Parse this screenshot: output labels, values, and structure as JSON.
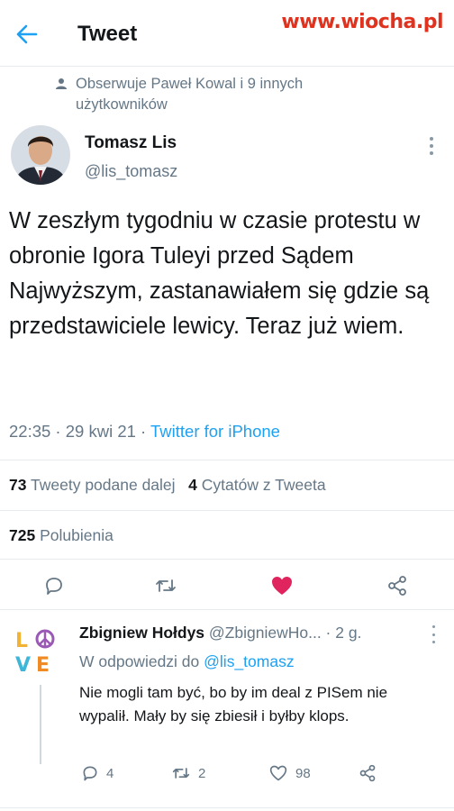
{
  "header": {
    "title": "Tweet"
  },
  "watermark": "www.wiocha.pl",
  "social_context": "Obserwuje Paweł Kowal i 9 innych użytkowników",
  "tweet": {
    "author_name": "Tomasz Lis",
    "author_handle": "@lis_tomasz",
    "text": "W zeszłym tygodniu w czasie protestu w obronie Igora  Tuleyi przed Sądem Najwyższym, zastanawiałem się gdzie  są przedstawiciele lewicy. Teraz już wiem.",
    "time": "22:35 · 29 kwi 21 · ",
    "source": "Twitter for iPhone",
    "retweets_count": "73",
    "retweets_label": "Tweety podane dalej",
    "quotes_count": "4",
    "quotes_label": "Cytatów z Tweeta",
    "likes_count": "725",
    "likes_label": "Polubienia"
  },
  "actions": {
    "reply_icon": "reply-icon",
    "retweet_icon": "retweet-icon",
    "like_icon": "heart-filled-icon",
    "share_icon": "share-icon",
    "like_color": "#e0245e"
  },
  "reply": {
    "avatar_text": "LOVE",
    "name": "Zbigniew Hołdys",
    "handle_time": "@ZbigniewHo... · 2 g.",
    "reply_to_label": "W odpowiedzi do",
    "reply_to_mention": "@lis_tomasz",
    "text": "Nie mogli tam być, bo by im deal z PISem nie wypalił. Mały by się zbiesił i byłby klops.",
    "reply_count": "4",
    "retweet_count": "2",
    "like_count": "98"
  },
  "colors": {
    "accent": "#1da1f2",
    "secondary_text": "#657786",
    "watermark": "#e0331f"
  }
}
